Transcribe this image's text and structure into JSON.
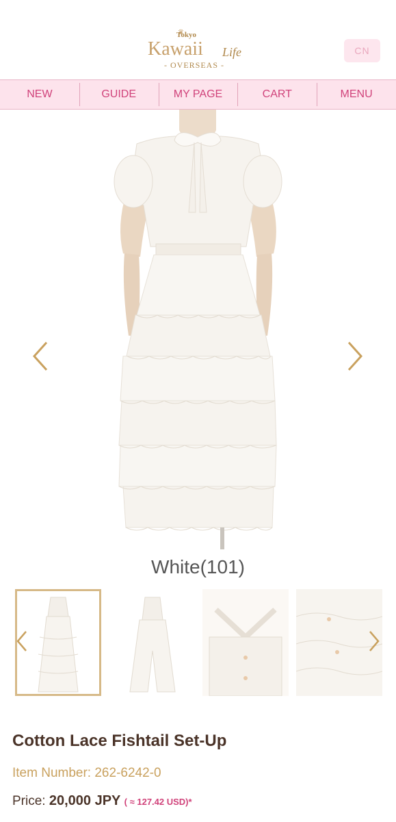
{
  "header": {
    "logo_small": "Tokyo",
    "logo_main": "Kawaii",
    "logo_life": "Life",
    "logo_sub": "- OVERSEAS -",
    "lang_button": "CN"
  },
  "nav": {
    "items": [
      {
        "label": "NEW"
      },
      {
        "label": "GUIDE"
      },
      {
        "label": "MY PAGE"
      },
      {
        "label": "CART"
      },
      {
        "label": "MENU"
      }
    ]
  },
  "product": {
    "color": "White(101)",
    "title": "Cotton Lace Fishtail Set-Up",
    "item_number": "Item Number: 262-6242-0",
    "price_label": "Price: ",
    "price_value": "20,000 JPY",
    "price_usd": "( ≈ 127.42 USD)*"
  },
  "colors": {
    "accent_pink": "#d0427a",
    "nav_bg": "#fde3ec",
    "gold": "#c9a15e"
  },
  "icons": {
    "prev": "chevron-left-icon",
    "next": "chevron-right-icon"
  }
}
